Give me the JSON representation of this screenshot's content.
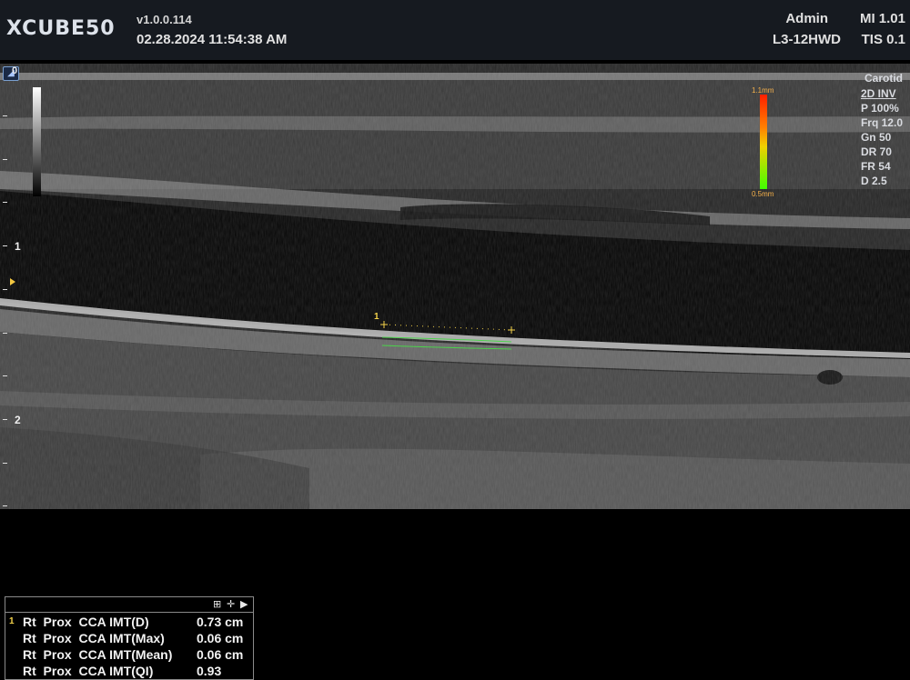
{
  "header": {
    "logo": "XCUBE50",
    "version": "v1.0.0.114",
    "datetime": "02.28.2024  11:54:38 AM",
    "user": "Admin",
    "mi": "MI 1.01",
    "probe": "L3-12HWD",
    "tis": "TIS 0.1"
  },
  "image": {
    "depth_zero": "0",
    "depth_labels": [
      "1",
      "2"
    ],
    "caliper_number": "1"
  },
  "scale": {
    "max": "1.1mm",
    "min": "0.5mm"
  },
  "params": {
    "preset": "Carotid",
    "mode": "2D INV",
    "power": "P 100%",
    "freq": "Frq 12.0",
    "gain": "Gn 50",
    "dr": "DR 70",
    "fr": "FR 54",
    "depth": "D 2.5"
  },
  "results": {
    "icons": [
      "grid-icon",
      "move-icon",
      "play-icon"
    ],
    "rows": [
      {
        "idx": "1",
        "label": "Rt  Prox  CCA IMT(D)",
        "value": "0.73 cm"
      },
      {
        "idx": "",
        "label": "Rt  Prox  CCA IMT(Max)",
        "value": "0.06 cm"
      },
      {
        "idx": "",
        "label": "Rt  Prox  CCA IMT(Mean)",
        "value": "0.06 cm"
      },
      {
        "idx": "",
        "label": "Rt  Prox  CCA IMT(QI)",
        "value": "0.93"
      }
    ]
  },
  "colors": {
    "caliper": "#f4d24a",
    "trace": "#4cd24c",
    "scale_text": "#f5b04a"
  }
}
